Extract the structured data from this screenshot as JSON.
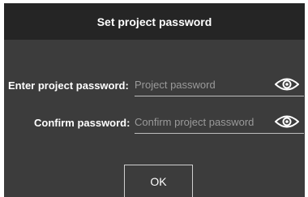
{
  "dialog": {
    "title": "Set project password",
    "fields": [
      {
        "label": "Enter project password:",
        "placeholder": "Project password",
        "value": "",
        "toggle_icon": "eye-icon"
      },
      {
        "label": "Confirm password:",
        "placeholder": "Confirm project password",
        "value": "",
        "toggle_icon": "eye-icon"
      }
    ],
    "ok_label": "OK"
  },
  "colors": {
    "dialog_bg": "#3c3c3c",
    "titlebar_bg": "#252525",
    "text": "#ffffff",
    "placeholder": "#9a9a9a",
    "underline": "#bdbdbd"
  }
}
